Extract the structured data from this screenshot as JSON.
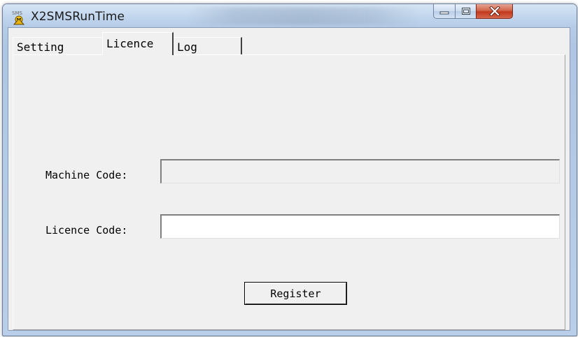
{
  "window": {
    "title": "X2SMSRunTime",
    "icon": "sms-app-icon",
    "icon_text": "SMS",
    "caption_buttons": [
      "minimize-icon",
      "maximize-icon",
      "close-icon"
    ]
  },
  "tabs": [
    {
      "label": "Setting",
      "selected": false
    },
    {
      "label": "Licence",
      "selected": true
    },
    {
      "label": "Log",
      "selected": false
    }
  ],
  "licence": {
    "machine_code_label": "Machine Code:",
    "machine_code_value": "",
    "licence_code_label": "Licence Code:",
    "licence_code_value": "",
    "register_label": "Register"
  },
  "colors": {
    "close_button": "#c2381c",
    "dialog_background": "#f0f0f0"
  }
}
